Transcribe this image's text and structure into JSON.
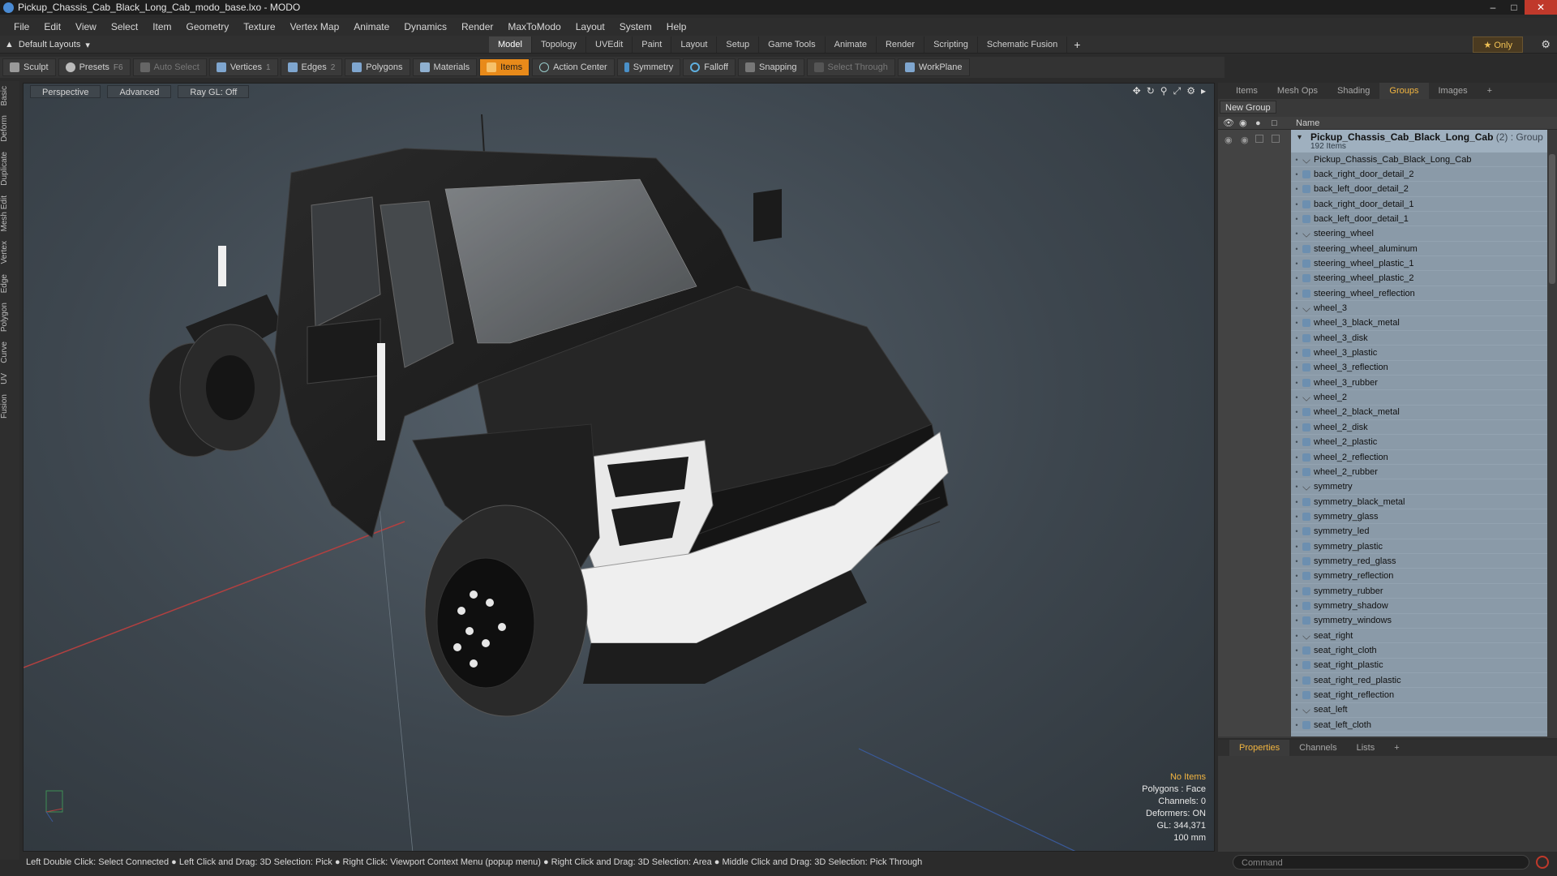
{
  "window": {
    "title": "Pickup_Chassis_Cab_Black_Long_Cab_modo_base.lxo - MODO"
  },
  "menu": [
    "File",
    "Edit",
    "View",
    "Select",
    "Item",
    "Geometry",
    "Texture",
    "Vertex Map",
    "Animate",
    "Dynamics",
    "Render",
    "MaxToModo",
    "Layout",
    "System",
    "Help"
  ],
  "layouts": {
    "label": "Default Layouts"
  },
  "layout_tabs": [
    "Model",
    "Topology",
    "UVEdit",
    "Paint",
    "Layout",
    "Setup",
    "Game Tools",
    "Animate",
    "Render",
    "Scripting",
    "Schematic Fusion"
  ],
  "layout_active": "Model",
  "only_label": "Only",
  "toolbar": {
    "sculpt": "Sculpt",
    "presets": "Presets",
    "presets_key": "F6",
    "auto_select": "Auto Select",
    "vertices": "Vertices",
    "vertices_count": "1",
    "edges": "Edges",
    "edges_count": "2",
    "polygons": "Polygons",
    "materials": "Materials",
    "items": "Items",
    "action_center": "Action Center",
    "symmetry": "Symmetry",
    "falloff": "Falloff",
    "snapping": "Snapping",
    "select_through": "Select Through",
    "workplane": "WorkPlane"
  },
  "left_tabs": [
    "Basic",
    "Deform",
    "Duplicate",
    "Mesh Edit",
    "Vertex",
    "Edge",
    "Polygon",
    "Curve",
    "UV",
    "Fusion"
  ],
  "viewport": {
    "perspective": "Perspective",
    "advanced": "Advanced",
    "raygl": "Ray GL: Off",
    "stats": {
      "selection": "No Items",
      "polygons": "Polygons : Face",
      "channels": "Channels: 0",
      "deformers": "Deformers: ON",
      "gl": "GL: 344,371",
      "scale": "100 mm"
    }
  },
  "right_panel": {
    "tabs": [
      "Items",
      "Mesh Ops",
      "Shading",
      "Groups",
      "Images"
    ],
    "active_tab": "Groups",
    "new_group": "New Group",
    "name_header": "Name",
    "group": {
      "name": "Pickup_Chassis_Cab_Black_Long_Cab",
      "suffix": "(2) : Group",
      "count": "192 Items"
    },
    "items": [
      {
        "name": "Pickup_Chassis_Cab_Black_Long_Cab",
        "type": "locator"
      },
      {
        "name": "back_right_door_detail_2",
        "type": "mesh"
      },
      {
        "name": "back_left_door_detail_2",
        "type": "mesh"
      },
      {
        "name": "back_right_door_detail_1",
        "type": "mesh"
      },
      {
        "name": "back_left_door_detail_1",
        "type": "mesh"
      },
      {
        "name": "steering_wheel",
        "type": "locator"
      },
      {
        "name": "steering_wheel_aluminum",
        "type": "mesh"
      },
      {
        "name": "steering_wheel_plastic_1",
        "type": "mesh"
      },
      {
        "name": "steering_wheel_plastic_2",
        "type": "mesh"
      },
      {
        "name": "steering_wheel_reflection",
        "type": "mesh"
      },
      {
        "name": "wheel_3",
        "type": "locator"
      },
      {
        "name": "wheel_3_black_metal",
        "type": "mesh"
      },
      {
        "name": "wheel_3_disk",
        "type": "mesh"
      },
      {
        "name": "wheel_3_plastic",
        "type": "mesh"
      },
      {
        "name": "wheel_3_reflection",
        "type": "mesh"
      },
      {
        "name": "wheel_3_rubber",
        "type": "mesh"
      },
      {
        "name": "wheel_2",
        "type": "locator"
      },
      {
        "name": "wheel_2_black_metal",
        "type": "mesh"
      },
      {
        "name": "wheel_2_disk",
        "type": "mesh"
      },
      {
        "name": "wheel_2_plastic",
        "type": "mesh"
      },
      {
        "name": "wheel_2_reflection",
        "type": "mesh"
      },
      {
        "name": "wheel_2_rubber",
        "type": "mesh"
      },
      {
        "name": "symmetry",
        "type": "locator"
      },
      {
        "name": "symmetry_black_metal",
        "type": "mesh"
      },
      {
        "name": "symmetry_glass",
        "type": "mesh"
      },
      {
        "name": "symmetry_led",
        "type": "mesh"
      },
      {
        "name": "symmetry_plastic",
        "type": "mesh"
      },
      {
        "name": "symmetry_red_glass",
        "type": "mesh"
      },
      {
        "name": "symmetry_reflection",
        "type": "mesh"
      },
      {
        "name": "symmetry_rubber",
        "type": "mesh"
      },
      {
        "name": "symmetry_shadow",
        "type": "mesh"
      },
      {
        "name": "symmetry_windows",
        "type": "mesh"
      },
      {
        "name": "seat_right",
        "type": "locator"
      },
      {
        "name": "seat_right_cloth",
        "type": "mesh"
      },
      {
        "name": "seat_right_plastic",
        "type": "mesh"
      },
      {
        "name": "seat_right_red_plastic",
        "type": "mesh"
      },
      {
        "name": "seat_right_reflection",
        "type": "mesh"
      },
      {
        "name": "seat_left",
        "type": "locator"
      },
      {
        "name": "seat_left_cloth",
        "type": "mesh"
      }
    ]
  },
  "properties_tabs": [
    "Properties",
    "Channels",
    "Lists"
  ],
  "properties_active": "Properties",
  "command": {
    "placeholder": "Command"
  },
  "status": "Left Double Click: Select Connected ● Left Click and Drag: 3D Selection: Pick ● Right Click: Viewport Context Menu (popup menu) ● Right Click and Drag: 3D Selection: Area ● Middle Click and Drag: 3D Selection: Pick Through",
  "colors": {
    "accent": "#e88a1a",
    "active_tab": "#f2b540",
    "list_bg": "#8a9aa8"
  }
}
